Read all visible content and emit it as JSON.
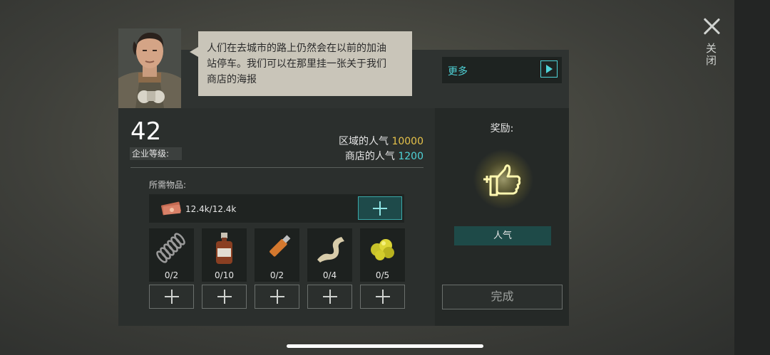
{
  "close": {
    "label": "关闭"
  },
  "dialog": {
    "text_line1": "人们在去城市的路上仍然会在以前的加油",
    "text_line2": "站停车。我们可以在那里挂一张关于我们",
    "text_line3": "商店的海报"
  },
  "more_button": {
    "label": "更多",
    "icon": "play-icon"
  },
  "enterprise": {
    "level": "42",
    "level_label": "企业等级:"
  },
  "popularity": {
    "area_label": "区域的人气",
    "area_value": "10000",
    "shop_label": "商店的人气",
    "shop_value": "1200",
    "colors": {
      "area": "#e6c24a",
      "shop": "#4fd3d8"
    }
  },
  "requirements": {
    "label": "所需物品:",
    "money": {
      "icon": "cash-icon",
      "amount": "12.4k/12.4k"
    },
    "items": [
      {
        "icon": "spring-icon",
        "count": "0/2"
      },
      {
        "icon": "bottle-icon",
        "count": "0/10"
      },
      {
        "icon": "usb-drive-icon",
        "count": "0/2"
      },
      {
        "icon": "tape-icon",
        "count": "0/4"
      },
      {
        "icon": "gold-nugget-icon",
        "count": "0/5"
      }
    ]
  },
  "reward": {
    "title": "奖励:",
    "icon": "thumbs-up-icon",
    "badge": "人气"
  },
  "complete_button": {
    "label": "完成"
  }
}
